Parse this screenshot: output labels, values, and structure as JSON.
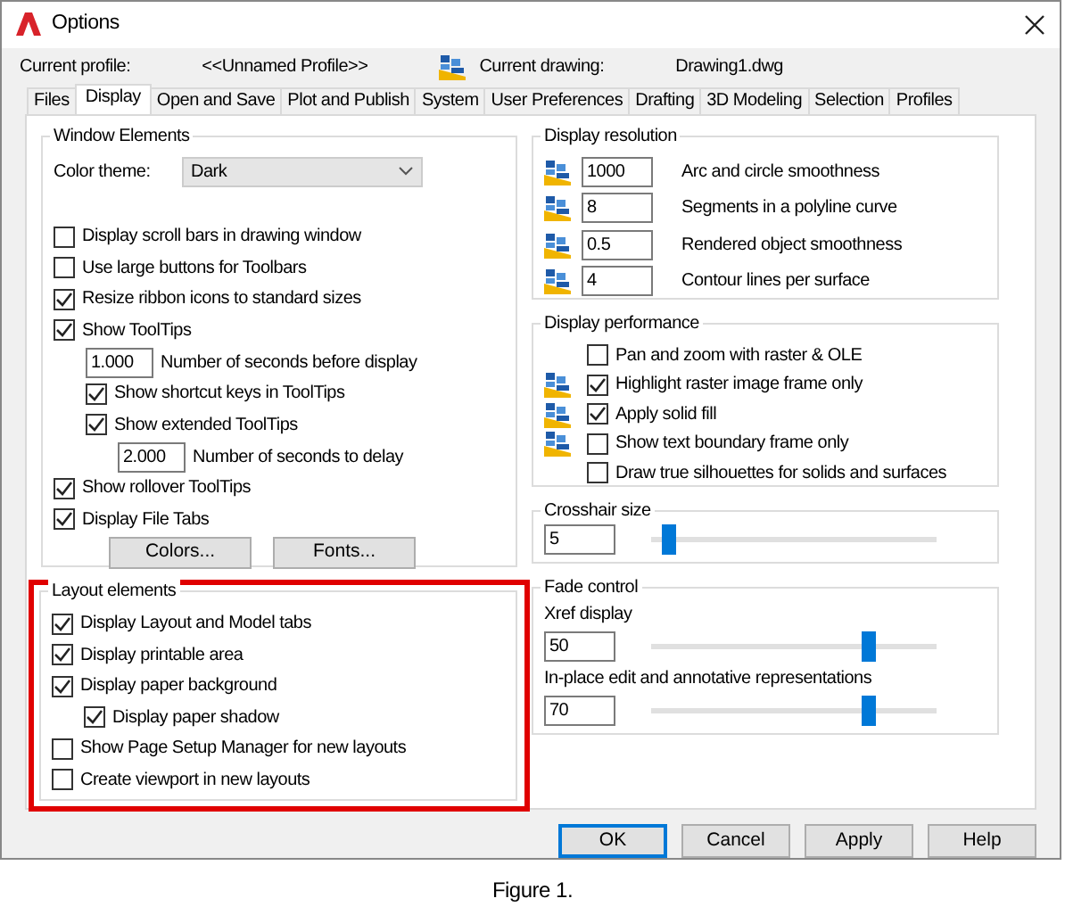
{
  "window": {
    "title": "Options"
  },
  "profile": {
    "label": "Current profile:",
    "value": "<<Unnamed Profile>>"
  },
  "drawing": {
    "label": "Current drawing:",
    "value": "Drawing1.dwg"
  },
  "tabs": [
    {
      "label": "Files",
      "selected": false
    },
    {
      "label": "Display",
      "selected": true
    },
    {
      "label": "Open and Save",
      "selected": false
    },
    {
      "label": "Plot and Publish",
      "selected": false
    },
    {
      "label": "System",
      "selected": false
    },
    {
      "label": "User Preferences",
      "selected": false
    },
    {
      "label": "Drafting",
      "selected": false
    },
    {
      "label": "3D Modeling",
      "selected": false
    },
    {
      "label": "Selection",
      "selected": false
    },
    {
      "label": "Profiles",
      "selected": false
    }
  ],
  "window_elements": {
    "title": "Window Elements",
    "color_theme": {
      "label": "Color theme:",
      "value": "Dark"
    },
    "items": [
      {
        "kind": "checkbox",
        "label": "Display scroll bars in drawing window",
        "checked": false
      },
      {
        "kind": "checkbox",
        "label": "Use large buttons for Toolbars",
        "checked": false
      },
      {
        "kind": "checkbox",
        "label": "Resize ribbon icons to standard sizes",
        "checked": true
      },
      {
        "kind": "checkbox",
        "label": "Show ToolTips",
        "checked": true,
        "children": [
          {
            "kind": "field",
            "value": "1.000",
            "label": "Number of seconds before display"
          },
          {
            "kind": "checkbox",
            "label": "Show shortcut keys in ToolTips",
            "checked": true
          },
          {
            "kind": "checkbox",
            "label": "Show extended ToolTips",
            "checked": true,
            "children": [
              {
                "kind": "field",
                "value": "2.000",
                "label": "Number of seconds to delay"
              }
            ]
          }
        ]
      },
      {
        "kind": "checkbox",
        "label": "Show rollover ToolTips",
        "checked": true
      },
      {
        "kind": "checkbox",
        "label": "Display File Tabs",
        "checked": true
      }
    ],
    "buttons": [
      "Colors...",
      "Fonts..."
    ]
  },
  "layout_elements": {
    "title": "Layout elements",
    "highlighted": true,
    "items": [
      {
        "kind": "checkbox",
        "label": "Display Layout and Model tabs",
        "checked": true
      },
      {
        "kind": "checkbox",
        "label": "Display printable area",
        "checked": true
      },
      {
        "kind": "checkbox",
        "label": "Display paper background",
        "checked": true,
        "children": [
          {
            "kind": "checkbox",
            "label": "Display paper shadow",
            "checked": true
          }
        ]
      },
      {
        "kind": "checkbox",
        "label": "Show Page Setup Manager for new layouts",
        "checked": false
      },
      {
        "kind": "checkbox",
        "label": "Create viewport in new layouts",
        "checked": false
      }
    ]
  },
  "display_resolution": {
    "title": "Display resolution",
    "items": [
      {
        "value": "1000",
        "label": "Arc and circle smoothness",
        "stored_in_drawing": true
      },
      {
        "value": "8",
        "label": "Segments in a polyline curve",
        "stored_in_drawing": true
      },
      {
        "value": "0.5",
        "label": "Rendered object smoothness",
        "stored_in_drawing": true
      },
      {
        "value": "4",
        "label": "Contour lines per surface",
        "stored_in_drawing": true
      }
    ]
  },
  "display_performance": {
    "title": "Display performance",
    "items": [
      {
        "label": "Pan and zoom with raster & OLE",
        "checked": false,
        "stored_in_drawing": false
      },
      {
        "label": "Highlight raster image frame only",
        "checked": true,
        "stored_in_drawing": true
      },
      {
        "label": "Apply solid fill",
        "checked": true,
        "stored_in_drawing": true
      },
      {
        "label": "Show text boundary frame only",
        "checked": false,
        "stored_in_drawing": true
      },
      {
        "label": "Draw true silhouettes for solids and surfaces",
        "checked": false,
        "stored_in_drawing": false
      }
    ]
  },
  "crosshair": {
    "title": "Crosshair size",
    "value": "5",
    "level": 0.06
  },
  "fade_control": {
    "title": "Fade control",
    "items": [
      {
        "label": "Xref display",
        "value": "50",
        "level": 0.76
      },
      {
        "label": "In-place edit and annotative representations",
        "value": "70",
        "level": 0.76
      }
    ]
  },
  "buttons": [
    {
      "label": "OK",
      "default": true
    },
    {
      "label": "Cancel",
      "default": false
    },
    {
      "label": "Apply",
      "default": false
    },
    {
      "label": "Help",
      "default": false
    }
  ],
  "caption": "Figure 1."
}
